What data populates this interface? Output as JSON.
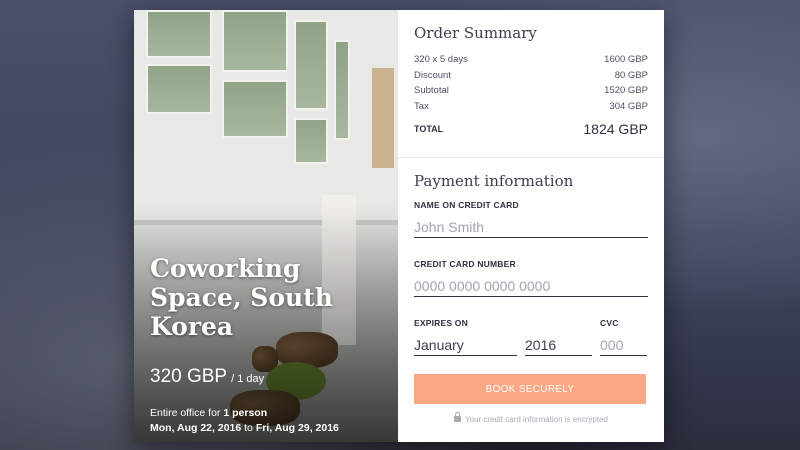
{
  "venue": {
    "title": "Coworking Space, South Korea",
    "price": "320 GBP",
    "price_unit": "/ 1 day",
    "capacity_prefix": "Entire office for",
    "capacity": "1 person",
    "date_from": "Mon, Aug 22, 2016",
    "date_to_word": "to",
    "date_to": "Fri, Aug 29, 2016"
  },
  "summary": {
    "title": "Order Summary",
    "lines": [
      {
        "label": "320 x 5 days",
        "value": "1600 GBP"
      },
      {
        "label": "Discount",
        "value": "80 GBP"
      },
      {
        "label": "Subtotal",
        "value": "1520 GBP"
      },
      {
        "label": "Tax",
        "value": "304 GBP"
      }
    ],
    "total_label": "TOTAL",
    "total_value": "1824 GBP"
  },
  "payment": {
    "title": "Payment information",
    "name_label": "NAME ON CREDIT CARD",
    "name_placeholder": "John Smith",
    "card_label": "CREDIT CARD NUMBER",
    "card_placeholder": "0000 0000 0000 0000",
    "expires_label": "EXPIRES ON",
    "month_value": "January",
    "year_value": "2016",
    "cvc_label": "CVC",
    "cvc_placeholder": "000",
    "button_label": "BOOK SECURELY",
    "secure_note": "Your credit card information is encrypted"
  },
  "colors": {
    "accent": "#fca784",
    "text_dark": "#2e3140"
  },
  "icons": {
    "lock": "lock-icon"
  }
}
